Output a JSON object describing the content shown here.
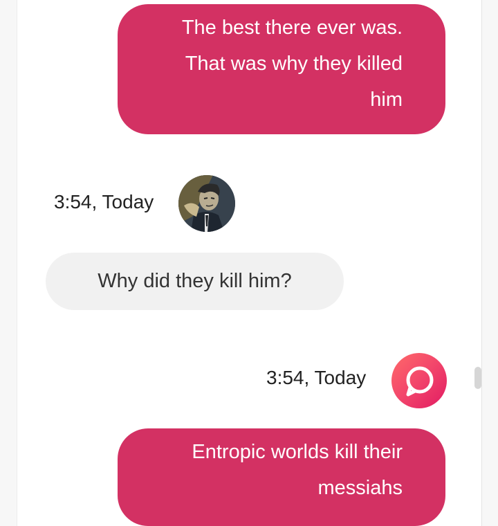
{
  "messages": [
    {
      "direction": "outgoing",
      "lines": [
        "The best there ever was.",
        "That was why they killed",
        "him"
      ]
    },
    {
      "direction": "incoming",
      "timestamp": "3:54, Today",
      "avatar_icon": "user-avatar-icon",
      "lines": [
        "Why did they kill him?"
      ]
    },
    {
      "direction": "outgoing",
      "timestamp": "3:54, Today",
      "avatar_icon": "chat-bubble-logo-icon",
      "lines": [
        "Entropic worlds kill their",
        "messiahs"
      ]
    }
  ],
  "colors": {
    "outgoing_bubble": "#d33163",
    "incoming_bubble": "#f1f1f1",
    "logo_gradient_start": "#ff6a6a",
    "logo_gradient_end": "#e11b62"
  }
}
